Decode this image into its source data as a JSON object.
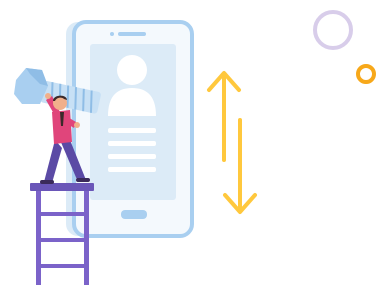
{
  "illustration": {
    "colors": {
      "phone_body": "#dcebf7",
      "phone_outline": "#a9cff0",
      "phone_screen": "#e9f3fb",
      "avatar": "#ffffff",
      "text_lines": "#ffffff",
      "home_button": "#a9cff0",
      "arrow": "#ffc83d",
      "ring_lavender": "#d8cdea",
      "ring_orange": "#f7a81a",
      "scaffold": "#7b63c9",
      "scaffold_top": "#6a56b8",
      "bolt": "#a9cff0",
      "bolt_dark": "#8fbde6",
      "person_shirt": "#e0457b",
      "person_pants": "#5b4aa5",
      "person_skin": "#f1b08b",
      "person_hair": "#3b2a2a"
    },
    "icons": [
      "smartphone",
      "profile-avatar",
      "double-vertical-arrow",
      "hex-bolt",
      "worker-figure",
      "ladder-scaffold",
      "lavender-ring",
      "orange-ring"
    ]
  }
}
